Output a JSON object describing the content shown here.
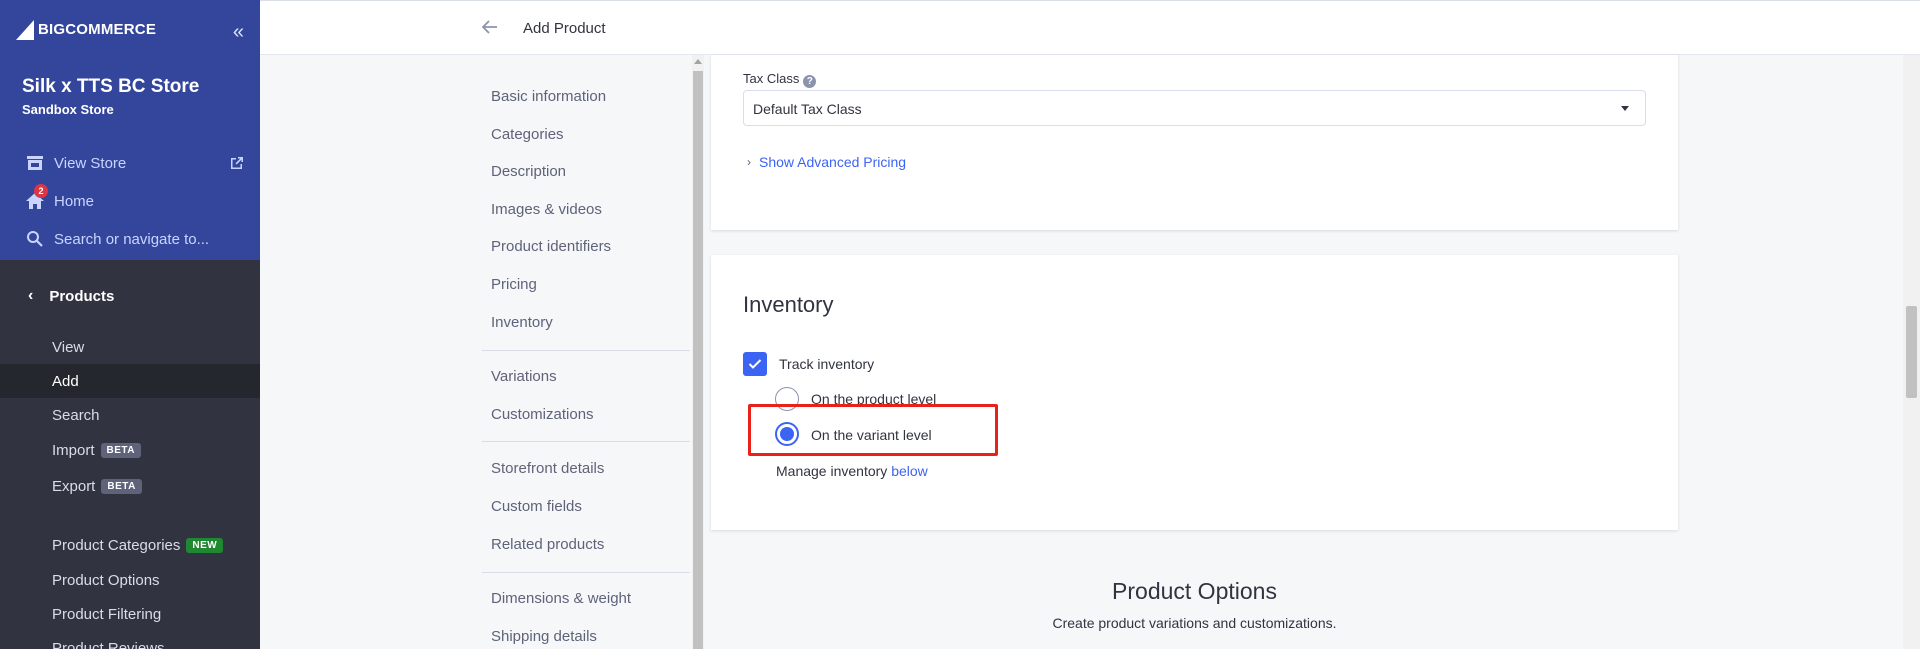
{
  "app": {
    "brand": "BIGCOMMERCE",
    "store_name": "Silk x TTS BC Store",
    "store_type": "Sandbox Store"
  },
  "sidebar": {
    "view_store": "View Store",
    "home": "Home",
    "home_badge": "2",
    "search_placeholder": "Search or navigate to...",
    "section": "Products",
    "items": [
      {
        "label": "View"
      },
      {
        "label": "Add"
      },
      {
        "label": "Search"
      },
      {
        "label": "Import",
        "tag": "BETA"
      },
      {
        "label": "Export",
        "tag": "BETA"
      },
      {
        "label": "Product Categories",
        "tag": "NEW"
      },
      {
        "label": "Product Options"
      },
      {
        "label": "Product Filtering"
      },
      {
        "label": "Product Reviews"
      }
    ]
  },
  "header": {
    "title": "Add Product"
  },
  "section_nav": {
    "items": [
      "Basic information",
      "Categories",
      "Description",
      "Images & videos",
      "Product identifiers",
      "Pricing",
      "Inventory",
      "Variations",
      "Customizations",
      "Storefront details",
      "Custom fields",
      "Related products",
      "Dimensions & weight",
      "Shipping details"
    ]
  },
  "pricing_card": {
    "tax_class_label": "Tax Class",
    "tax_class_value": "Default Tax Class",
    "advanced_link": "Show Advanced Pricing"
  },
  "inventory_card": {
    "title": "Inventory",
    "track_label": "Track inventory",
    "track_checked": true,
    "option_product": "On the product level",
    "option_variant": "On the variant level",
    "selected": "On the variant level",
    "manage_text": "Manage inventory",
    "manage_link": "below"
  },
  "product_options": {
    "title": "Product Options",
    "subtitle": "Create product variations and customizations."
  },
  "colors": {
    "accent": "#3c64f4",
    "sidebar_top": "#34469c",
    "sidebar": "#313440",
    "highlight": "#e8221b",
    "new_tag": "#208831"
  }
}
